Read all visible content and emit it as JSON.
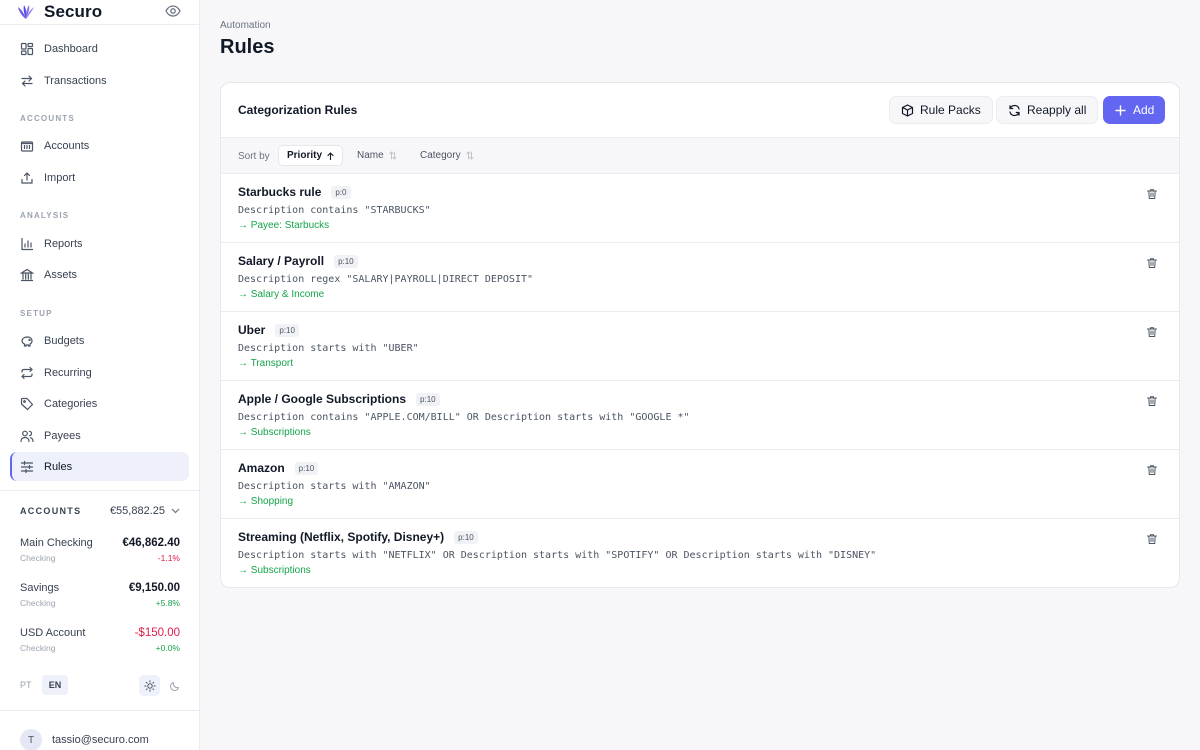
{
  "app": {
    "name": "Securo"
  },
  "sidebar": {
    "nav_top": [
      {
        "label": "Dashboard",
        "icon": "dashboard-icon"
      },
      {
        "label": "Transactions",
        "icon": "transfer-arrows-icon"
      }
    ],
    "sections": [
      {
        "label": "ACCOUNTS",
        "items": [
          {
            "label": "Accounts",
            "icon": "bank-icon"
          },
          {
            "label": "Import",
            "icon": "upload-icon"
          }
        ]
      },
      {
        "label": "ANALYSIS",
        "items": [
          {
            "label": "Reports",
            "icon": "bar-chart-icon"
          },
          {
            "label": "Assets",
            "icon": "building-icon"
          }
        ]
      },
      {
        "label": "SETUP",
        "items": [
          {
            "label": "Budgets",
            "icon": "piggy-bank-icon"
          },
          {
            "label": "Recurring",
            "icon": "repeat-icon"
          },
          {
            "label": "Categories",
            "icon": "tag-icon"
          },
          {
            "label": "Payees",
            "icon": "users-icon"
          },
          {
            "label": "Rules",
            "icon": "sliders-icon",
            "active": true
          }
        ]
      }
    ],
    "accounts": {
      "label": "ACCOUNTS",
      "total": "€55,882.25",
      "items": [
        {
          "name": "Main Checking",
          "type": "Checking",
          "balance": "€46,862.40",
          "change": "-1.1%"
        },
        {
          "name": "Savings",
          "type": "Checking",
          "balance": "€9,150.00",
          "change": "+5.8%"
        },
        {
          "name": "USD Account",
          "type": "Checking",
          "balance": "-$150.00",
          "change": "+0.0%"
        }
      ]
    },
    "languages": [
      "PT",
      "EN"
    ],
    "active_language": "EN",
    "user": {
      "initial": "T",
      "email": "tassio@securo.com"
    }
  },
  "main": {
    "breadcrumb": "Automation",
    "title": "Rules",
    "card": {
      "title": "Categorization Rules",
      "buttons": {
        "rule_packs": "Rule Packs",
        "reapply": "Reapply all",
        "add": "Add"
      },
      "sort": {
        "label": "Sort by",
        "options": [
          {
            "label": "Priority",
            "active": true
          },
          {
            "label": "Name"
          },
          {
            "label": "Category"
          }
        ]
      },
      "rules": [
        {
          "name": "Starbucks rule",
          "priority": "p:0",
          "condition": "Description contains \"STARBUCKS\"",
          "action": "→ Payee: Starbucks"
        },
        {
          "name": "Salary / Payroll",
          "priority": "p:10",
          "condition": "Description regex \"SALARY|PAYROLL|DIRECT DEPOSIT\"",
          "action": "→ Salary & Income"
        },
        {
          "name": "Uber",
          "priority": "p:10",
          "condition": "Description starts with \"UBER\"",
          "action": "→ Transport"
        },
        {
          "name": "Apple / Google Subscriptions",
          "priority": "p:10",
          "condition": "Description contains \"APPLE.COM/BILL\" OR Description starts with \"GOOGLE *\"",
          "action": "→ Subscriptions"
        },
        {
          "name": "Amazon",
          "priority": "p:10",
          "condition": "Description starts with \"AMAZON\"",
          "action": "→ Shopping"
        },
        {
          "name": "Streaming (Netflix, Spotify, Disney+)",
          "priority": "p:10",
          "condition": "Description starts with \"NETFLIX\" OR Description starts with \"SPOTIFY\" OR Description starts with \"DISNEY\"",
          "action": "→ Subscriptions"
        }
      ]
    }
  },
  "colors": {
    "accent": "#6366f1",
    "positive": "#16a34a",
    "negative": "#e11d48"
  }
}
